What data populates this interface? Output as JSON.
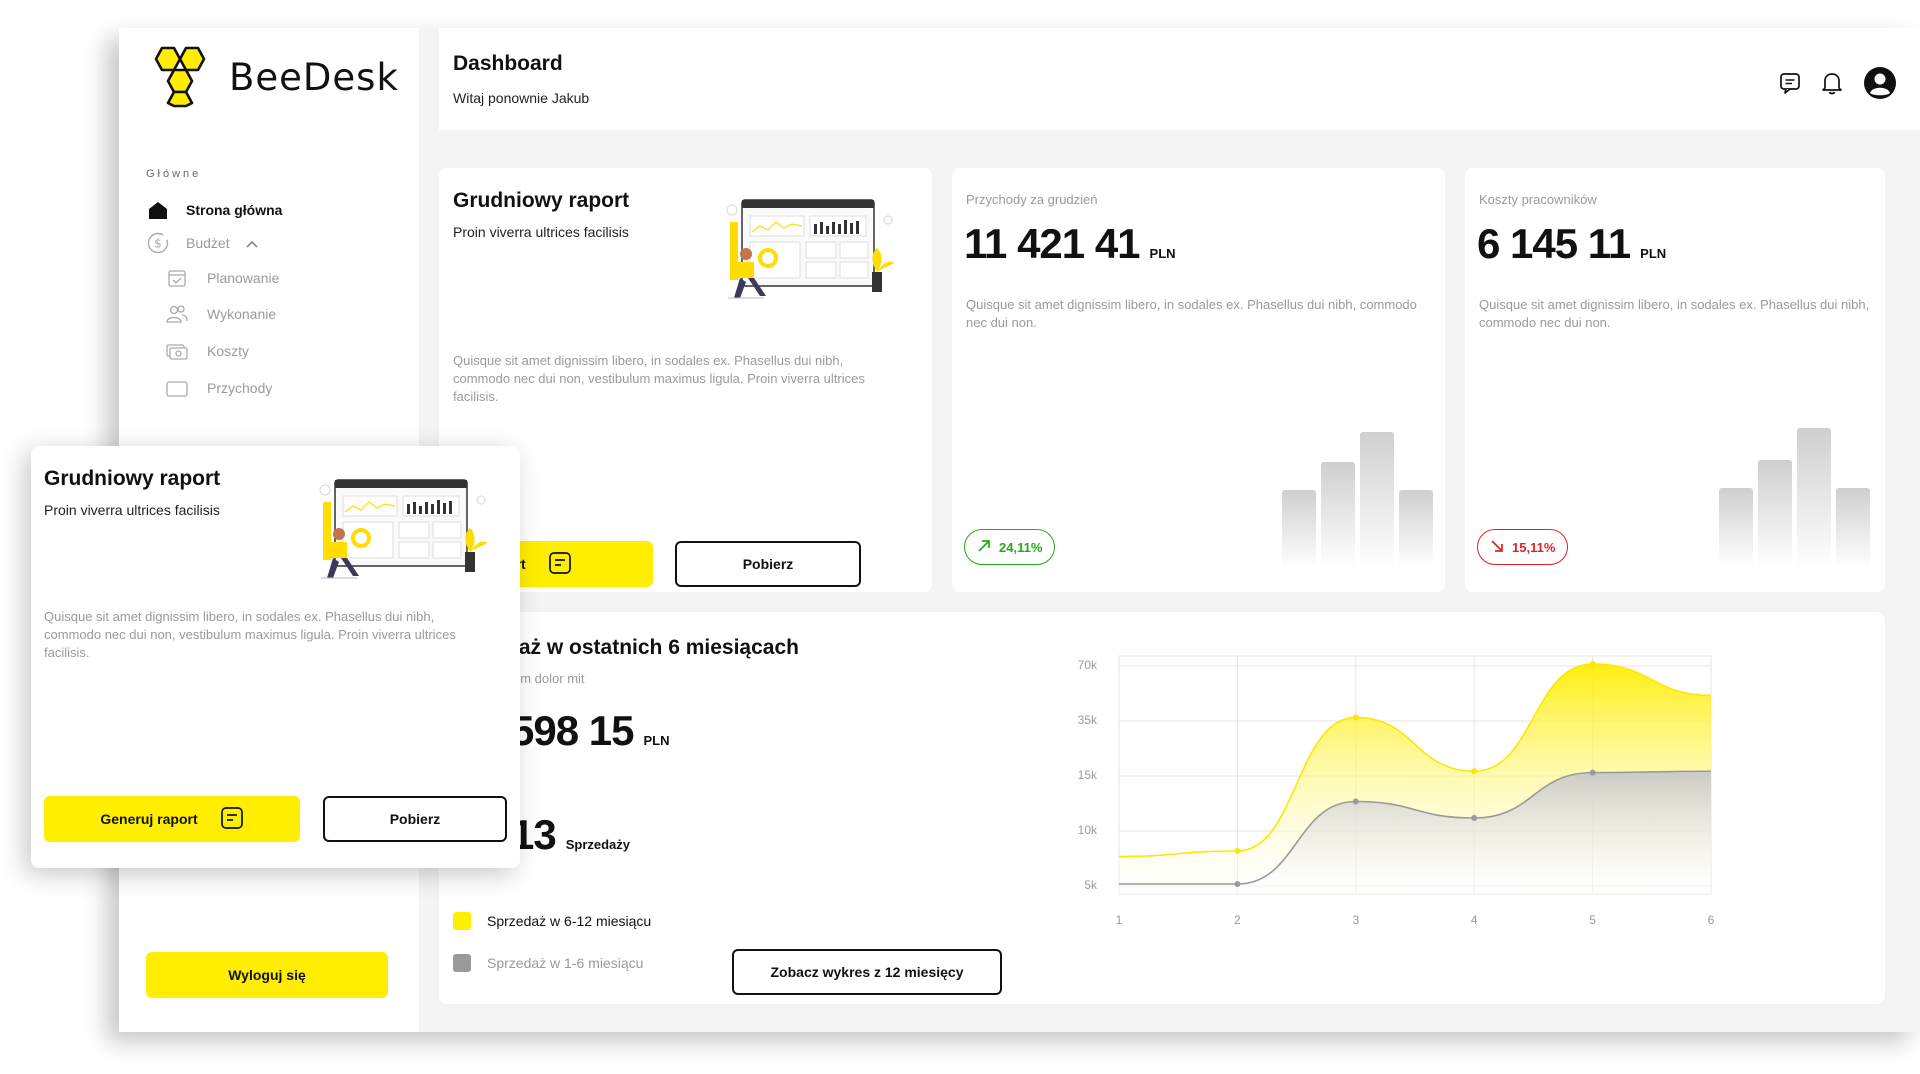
{
  "app": {
    "name": "BeeDesk"
  },
  "sidebar": {
    "section_label": "Główne",
    "items": [
      {
        "label": "Strona główna",
        "icon": "home-icon"
      },
      {
        "label": "Budżet",
        "icon": "dollar-circle-icon"
      },
      {
        "label": "Planowanie",
        "icon": "calendar-check-icon"
      },
      {
        "label": "Wykonanie",
        "icon": "users-icon"
      },
      {
        "label": "Koszty",
        "icon": "cash-icon"
      },
      {
        "label": "Przychody",
        "icon": "wallet-icon"
      }
    ],
    "logout_label": "Wyloguj się"
  },
  "header": {
    "title": "Dashboard",
    "subtitle": "Witaj ponownie Jakub",
    "icons": [
      "message-icon",
      "bell-icon",
      "account-icon"
    ]
  },
  "report_card": {
    "title": "Grudniowy raport",
    "subtitle": "Proin viverra ultrices facilisis",
    "description": "Quisque sit amet dignissim libero, in sodales ex. Phasellus dui nibh, commodo nec dui non, vestibulum maximus ligula. Proin viverra ultrices facilisis.",
    "generate_label": "Generuj raport",
    "download_label": "Pobierz"
  },
  "revenue_card": {
    "label": "Przychody za grudzień",
    "value": "11 421 41",
    "unit": "PLN",
    "description": "Quisque sit amet dignissim libero, in sodales ex. Phasellus dui nibh, commodo nec dui non.",
    "change": "24,11%",
    "trend": "up",
    "trend_color": "#27a81b"
  },
  "costs_card": {
    "label": "Koszty pracowników",
    "value": "6 145 11",
    "unit": "PLN",
    "description": "Quisque sit amet dignissim libero, in sodales ex. Phasellus dui nibh, commodo nec dui non.",
    "change": "15,11%",
    "trend": "down",
    "trend_color": "#e02424"
  },
  "sales_card": {
    "title": "laż w ostatnich 6 miesiącach",
    "subtitle": "um dolor mit",
    "value": "598 15",
    "unit": "PLN",
    "count": "13",
    "count_label": "Sprzedaży",
    "legend": [
      {
        "label": "Sprzedaż w 6-12 miesiącu",
        "color": "#ffee00"
      },
      {
        "label": "Sprzedaż w 1-6 miesiącu",
        "color": "#9a9a9a"
      }
    ],
    "chart_button": "Zobacz wykres z 12 miesięcy"
  },
  "chart_data": {
    "type": "area",
    "x": [
      1,
      2,
      3,
      4,
      5,
      6
    ],
    "y_ticks": [
      "70k",
      "35k",
      "15k",
      "10k",
      "5k"
    ],
    "series": [
      {
        "name": "Sprzedaż w 6-12 miesiącu",
        "values": [
          7.5,
          8,
          36,
          16,
          70,
          50
        ],
        "color": "#ffee00"
      },
      {
        "name": "Sprzedaż w 1-6 miesiącu",
        "values": [
          5,
          5,
          12.5,
          11,
          15.5,
          16
        ],
        "color": "#9a9a9a"
      }
    ],
    "grid": true
  },
  "colors": {
    "accent": "#ffee00",
    "background": "#f4f4f4"
  }
}
